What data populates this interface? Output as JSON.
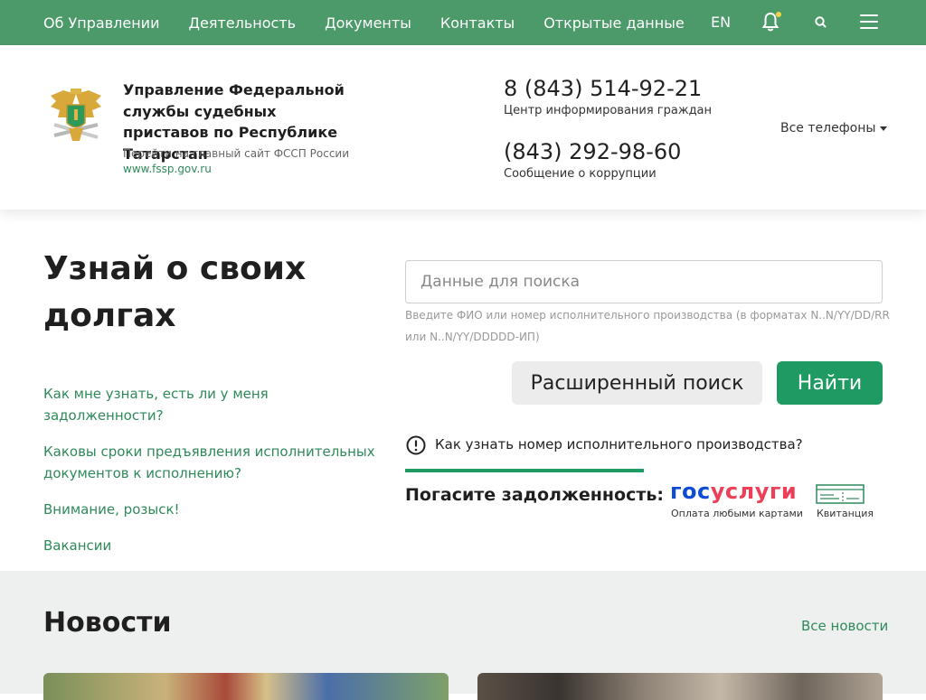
{
  "topbar": {
    "nav": [
      "Об Управлении",
      "Деятельность",
      "Документы",
      "Контакты",
      "Открытые данные"
    ],
    "lang": "EN",
    "icons": [
      "bell-icon",
      "search-icon",
      "menu-icon"
    ]
  },
  "header": {
    "org_title": "Управление Федеральной службы судебных приставов по Республике Татарстан",
    "main_site_caption": "Перейти на главный сайт ФССП России",
    "main_site_link": "www.fssp.gov.ru",
    "phone1": "8 (843) 514-92-21",
    "phone1_caption": "Центр информирования граждан",
    "phone2": "(843) 292-98-60",
    "phone2_caption": "Сообщение о коррупции",
    "all_phones": "Все телефоны"
  },
  "hero": {
    "title": "Узнай о своих долгах",
    "links": [
      "Как мне узнать, есть ли у меня задолженности?",
      "Каковы сроки предъявления исполнительных документов к исполнению?",
      "Внимание, розыск!",
      "Вакансии"
    ],
    "search_placeholder": "Данные для поиска",
    "search_hint": "Введите ФИО или номер исполнительного производства (в форматах N..N/YY/DD/RR или N..N/YY/DDDDD-ИП)",
    "advanced_search": "Расширенный поиск",
    "find": "Найти",
    "how_to_find": "Как узнать номер исполнительного производства?",
    "pay_title": "Погасите задолженность:",
    "gosuslugi_a": "гос",
    "gosuslugi_b": "услуги",
    "gosuslugi_caption": "Оплата любыми картами",
    "receipt_caption": "Квитанция"
  },
  "news": {
    "title": "Новости",
    "all": "Все новости"
  },
  "colors": {
    "topbar": "#4c9a6a",
    "accent": "#1f9a62",
    "link": "#2f8a5a",
    "gos_blue": "#0d4cd3",
    "gos_red": "#ee3f58"
  }
}
